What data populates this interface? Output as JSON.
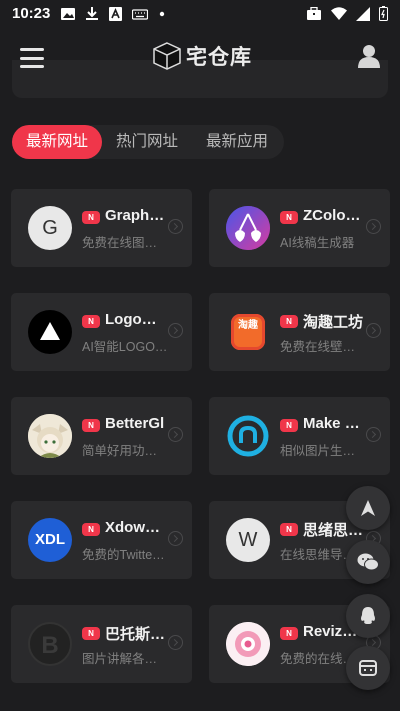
{
  "status_bar": {
    "time": "10:23"
  },
  "header": {
    "logo_text": "宅仓库"
  },
  "tabs": [
    {
      "label": "最新网址",
      "active": true
    },
    {
      "label": "热门网址",
      "active": false
    },
    {
      "label": "最新应用",
      "active": false
    }
  ],
  "badge_label": "N",
  "cards": [
    {
      "title": "Graph …",
      "desc": "免费在线图…",
      "icon": "letter-g-icon",
      "icon_letter": "G"
    },
    {
      "title": "ZColori…",
      "desc": "AI线稿生成器",
      "icon": "cherry-icon"
    },
    {
      "title": "Logom…",
      "desc": "AI智能LOGO…",
      "icon": "triangle-logo-icon"
    },
    {
      "title": "淘趣工坊",
      "desc": "免费在线壁…",
      "icon": "taoqu-app-icon",
      "icon_letter": "淘趣"
    },
    {
      "title": "BetterGl",
      "desc": "简单好用功…",
      "icon": "anime-avatar-icon"
    },
    {
      "title": "Make F…",
      "desc": "相似图片生…",
      "icon": "ring-logo-icon"
    },
    {
      "title": "Xdownl…",
      "desc": "免费的Twitte…",
      "icon": "xdl-logo-icon",
      "icon_letter": "XDL"
    },
    {
      "title": "思绪思…",
      "desc": "在线思维导…",
      "icon": "letter-w-icon",
      "icon_letter": "W"
    },
    {
      "title": "巴托斯…",
      "desc": "图片讲解各…",
      "icon": "b-logo-icon",
      "icon_letter": "B"
    },
    {
      "title": "Revize…",
      "desc": "免费的在线…",
      "icon": "pink-circle-icon"
    }
  ],
  "fabs": [
    "navigate-up-icon",
    "wechat-icon",
    "qq-icon",
    "grid-box-icon"
  ],
  "colors": {
    "accent": "#f0364a",
    "background": "#1d1d1f",
    "card": "#2a2a2c"
  }
}
